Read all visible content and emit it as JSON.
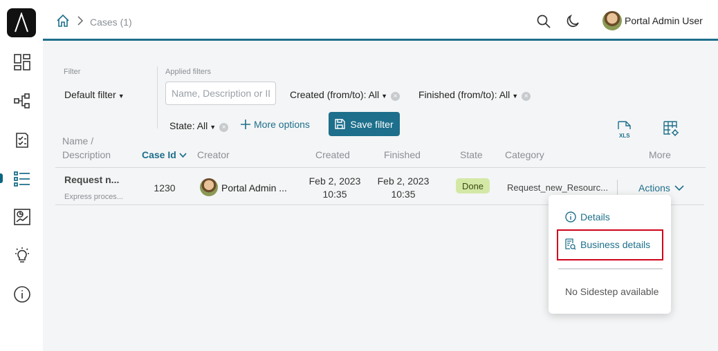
{
  "colors": {
    "accent": "#1d6f8b",
    "done_badge": "#d4e8a6",
    "highlight": "#d0021b"
  },
  "header": {
    "breadcrumb": "Cases (1)",
    "user_name": "Portal Admin User"
  },
  "sidebar": {
    "items": [
      {
        "icon": "dashboard-icon"
      },
      {
        "icon": "process-icon"
      },
      {
        "icon": "tasks-icon"
      },
      {
        "icon": "cases-icon",
        "active": true
      },
      {
        "icon": "statistics-icon"
      },
      {
        "icon": "ideas-icon"
      },
      {
        "icon": "info-icon"
      }
    ]
  },
  "filter": {
    "label": "Filter",
    "default": "Default filter",
    "applied_label": "Applied filters",
    "search_placeholder": "Name, Description or ID",
    "created": "Created (from/to): All",
    "finished": "Finished (from/to): All",
    "state": "State: All",
    "more_options": "More options",
    "save_filter": "Save filter"
  },
  "table": {
    "columns": {
      "name_line1": "Name /",
      "name_line2": "Description",
      "case_id": "Case Id",
      "creator": "Creator",
      "created": "Created",
      "finished": "Finished",
      "state": "State",
      "category": "Category",
      "more": "More"
    },
    "rows": [
      {
        "title": "Request n...",
        "description": "Express proces...",
        "case_id": "1230",
        "creator": "Portal Admin ...",
        "created_date": "Feb 2, 2023",
        "created_time": "10:35",
        "finished_date": "Feb 2, 2023",
        "finished_time": "10:35",
        "state": "Done",
        "category": "Request_new_Resourc...",
        "actions": "Actions"
      }
    ]
  },
  "dropdown": {
    "details": "Details",
    "business_details": "Business details",
    "no_sidestep": "No Sidestep available"
  }
}
